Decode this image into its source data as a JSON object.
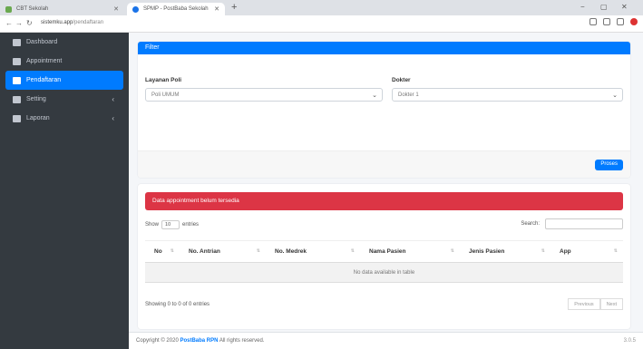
{
  "browser": {
    "tabs": [
      {
        "label": "CBT Sekolah"
      },
      {
        "label": "SPMP - PostBaba Sekolah"
      }
    ],
    "new_tab": "+",
    "controls": {
      "minimize": "−",
      "maximize": "▢",
      "close": "✕"
    },
    "url_host": "sistemku.app",
    "url_path": "/pendaftaran"
  },
  "sidebar": {
    "items": [
      {
        "label": "Dashboard"
      },
      {
        "label": "Appointment"
      },
      {
        "label": "Pendaftaran"
      },
      {
        "label": "Setting",
        "caret": "‹"
      },
      {
        "label": "Laporan",
        "caret": "‹"
      }
    ]
  },
  "filter": {
    "title": "Filter",
    "layanan_label": "Layanan Poli",
    "layanan_value": "Poli UMUM",
    "dokter_label": "Dokter",
    "dokter_value": "Dokter 1",
    "button": "Proses"
  },
  "table_card": {
    "alert": "Data appointment belum tersedia",
    "show_label": "Show",
    "entries_value": "10",
    "entries_label": "entries",
    "search_label": "Search:",
    "columns": [
      "No",
      "No. Antrian",
      "No. Medrek",
      "Nama Pasien",
      "Jenis Pasien",
      "App"
    ],
    "empty_text": "No data available in table",
    "info": "Showing 0 to 0 of 0 entries",
    "prev": "Previous",
    "next": "Next"
  },
  "footer": {
    "copyright": "Copyright © 2020",
    "brand": "PostBaba RPN",
    "rights": "All rights reserved.",
    "version": "3.0.5"
  },
  "colors": {
    "primary": "#007bff",
    "danger": "#dc3545",
    "sidebar": "#343a40"
  }
}
